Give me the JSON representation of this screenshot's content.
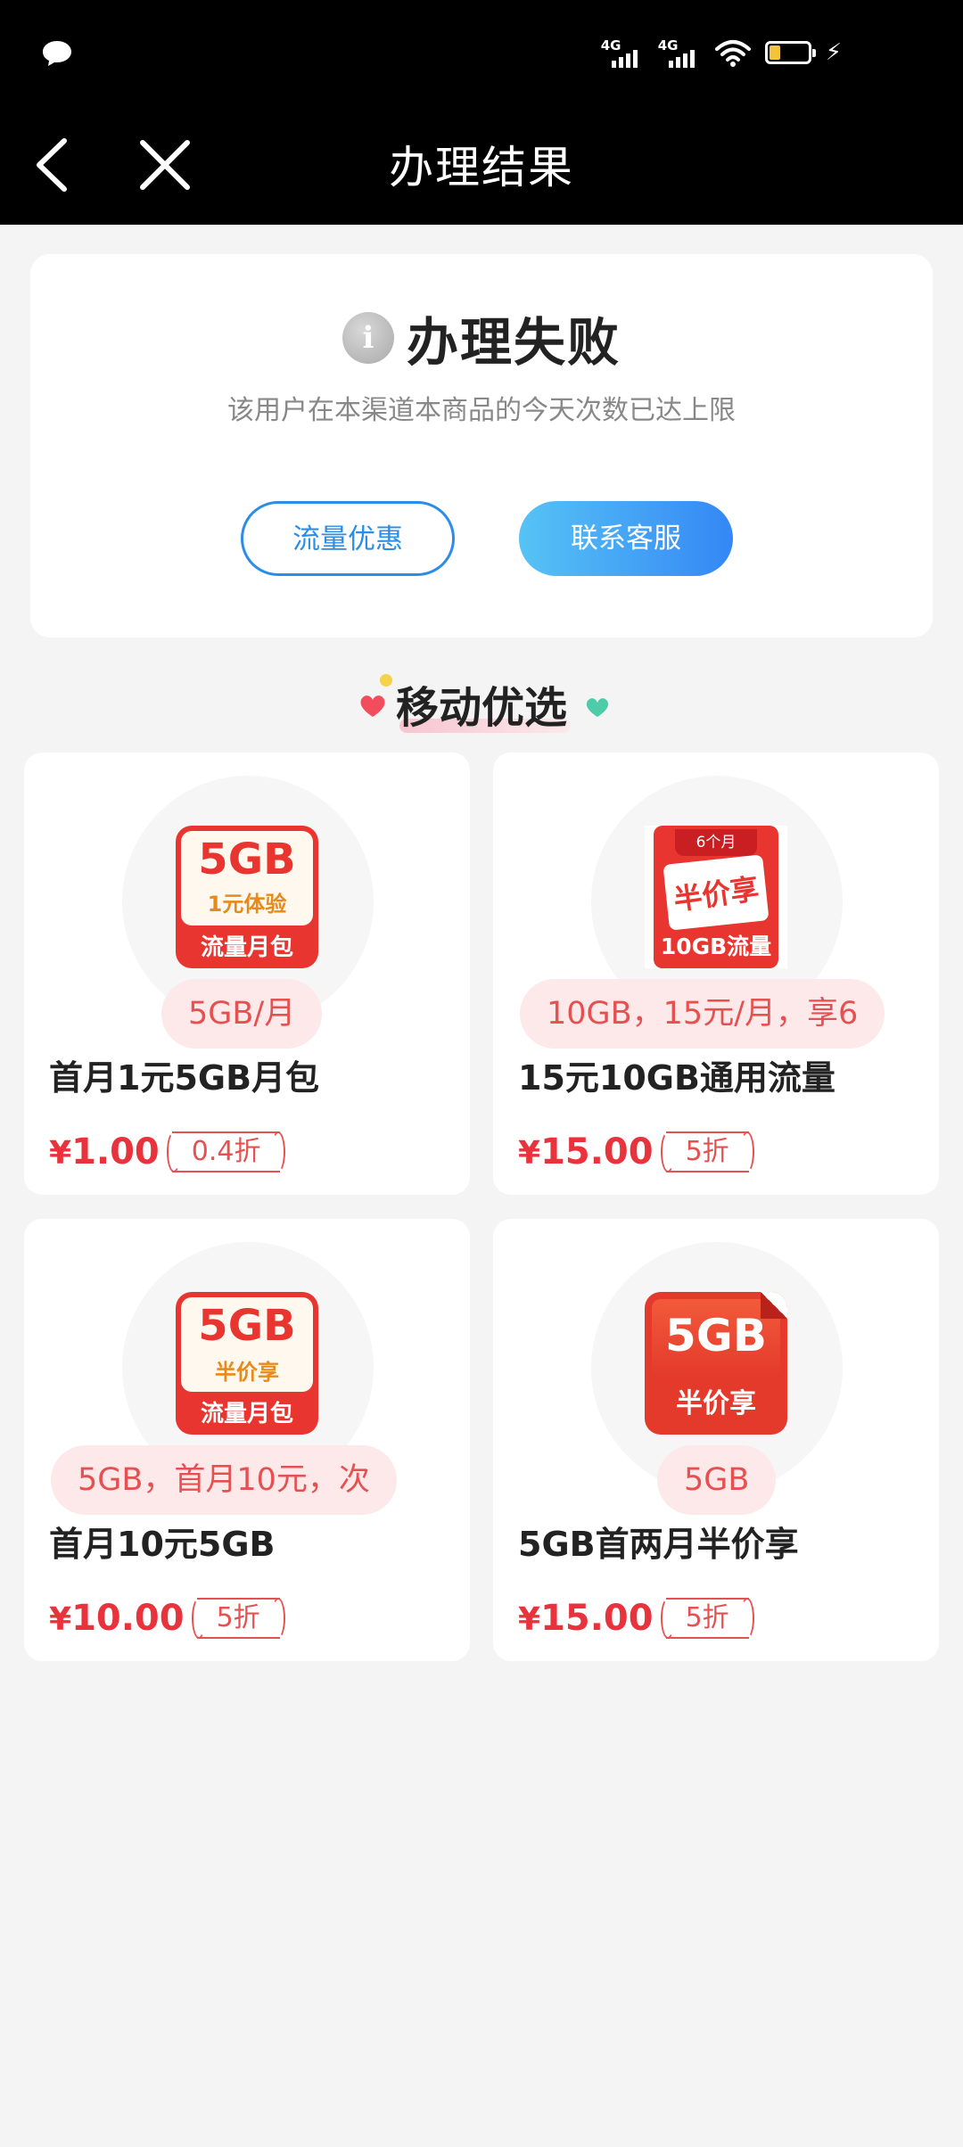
{
  "nav": {
    "title": "办理结果"
  },
  "status_bar": {
    "signal1": "4G",
    "signal2": "4G"
  },
  "result": {
    "title": "办理失败",
    "message": "该用户在本渠道本商品的今天次数已达上限",
    "btn_traffic": "流量优惠",
    "btn_service": "联系客服"
  },
  "section": {
    "title": "移动优选"
  },
  "products": [
    {
      "thumb_big": "5GB",
      "thumb_mid": "1元体验",
      "thumb_bottom": "流量月包",
      "tag": "5GB/月",
      "name": "首月1元5GB月包",
      "currency": "¥",
      "price": "1.00",
      "discount": "0.4折"
    },
    {
      "thumb_top": "6个月",
      "thumb_mid": "半价享",
      "thumb_bottom": "10GB流量",
      "tag": "10GB，15元/月，享6",
      "name": "15元10GB通用流量",
      "currency": "¥",
      "price": "15.00",
      "discount": "5折"
    },
    {
      "thumb_big": "5GB",
      "thumb_mid": "半价享",
      "thumb_bottom": "流量月包",
      "tag": "5GB，首月10元，次",
      "name": "首月10元5GB",
      "currency": "¥",
      "price": "10.00",
      "discount": "5折"
    },
    {
      "thumb_big": "5GB",
      "thumb_bottom": "半价享",
      "tag": "5GB",
      "name": "5GB首两月半价享",
      "currency": "¥",
      "price": "15.00",
      "discount": "5折"
    }
  ]
}
